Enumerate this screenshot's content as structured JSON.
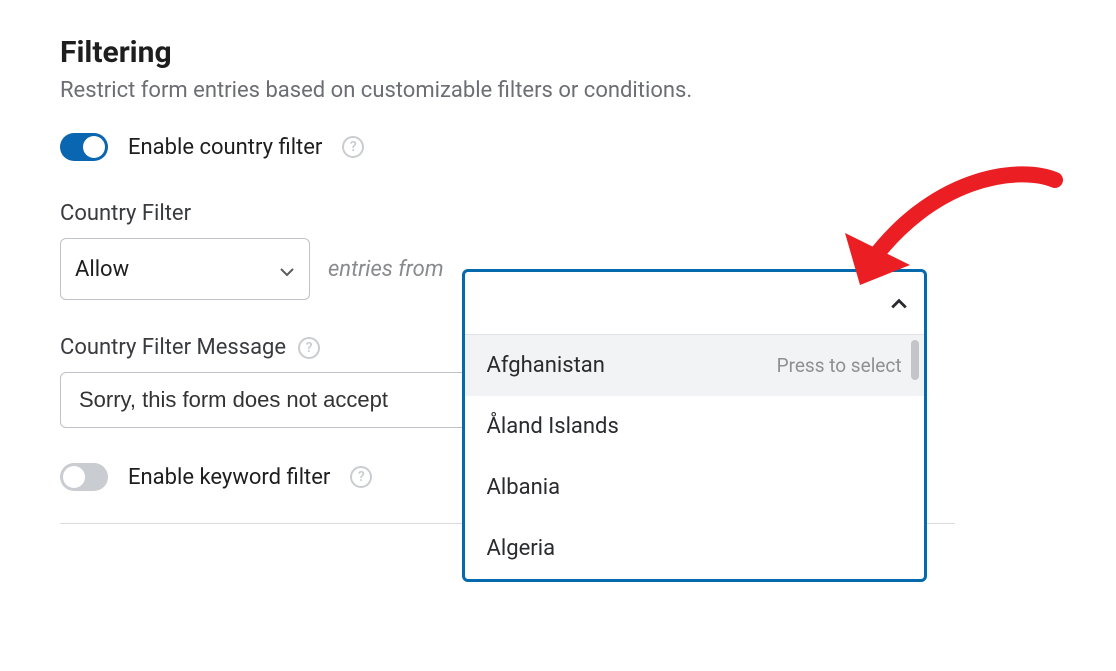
{
  "section": {
    "title": "Filtering",
    "description": "Restrict form entries based on customizable filters or conditions."
  },
  "countryFilter": {
    "toggleLabel": "Enable country filter",
    "enabled": true,
    "fieldLabel": "Country Filter",
    "modeSelected": "Allow",
    "entriesFromText": "entries from",
    "dropdown": {
      "options": [
        {
          "label": "Afghanistan",
          "hint": "Press to select"
        },
        {
          "label": "Åland Islands",
          "hint": ""
        },
        {
          "label": "Albania",
          "hint": ""
        },
        {
          "label": "Algeria",
          "hint": ""
        }
      ]
    },
    "message": {
      "label": "Country Filter Message",
      "value": "Sorry, this form does not accept"
    }
  },
  "keywordFilter": {
    "toggleLabel": "Enable keyword filter",
    "enabled": false
  },
  "colors": {
    "accent": "#056aab",
    "arrow": "#eb1f23"
  }
}
